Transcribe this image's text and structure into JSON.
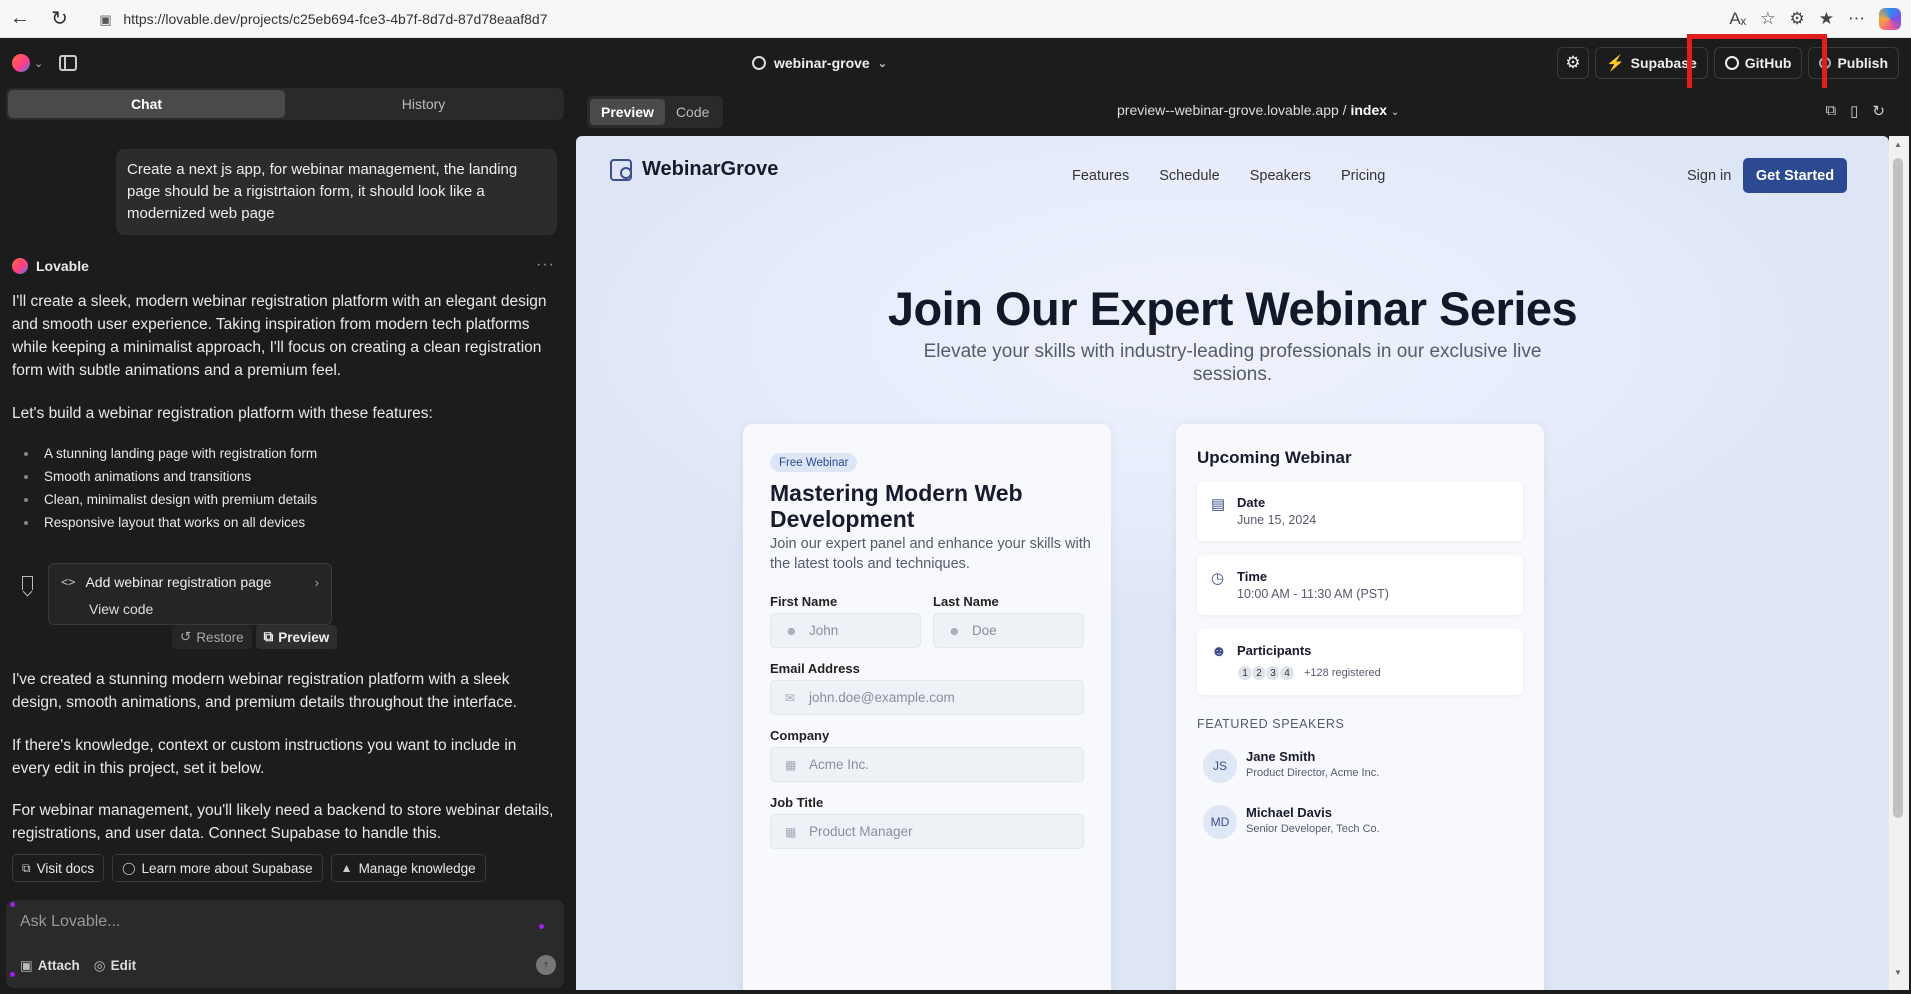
{
  "browser": {
    "url": "https://lovable.dev/projects/c25eb694-fce3-4b7f-8d7d-87d78eaaf8d7"
  },
  "header": {
    "project_name": "webinar-grove",
    "supabase_label": "Supabase",
    "github_label": "GitHub",
    "publish_label": "Publish"
  },
  "chat": {
    "tabs": [
      "Chat",
      "History"
    ],
    "user_message": "Create a next js app, for webinar management, the landing page should be a rigistrtaion form, it should look like a modernized web page",
    "bot_name": "Lovable",
    "intro": "I'll create a sleek, modern webinar registration platform with an elegant design and smooth user experience. Taking inspiration from modern tech platforms while keeping a minimalist approach, I'll focus on creating a clean registration form with subtle animations and a premium feel.",
    "features_intro": "Let's build a webinar registration platform with these features:",
    "features": [
      "A stunning landing page with registration form",
      "Smooth animations and transitions",
      "Clean, minimalist design with premium details",
      "Responsive layout that works on all devices"
    ],
    "version_title": "Add webinar registration page",
    "version_view_code": "View code",
    "restore_label": "Restore",
    "preview_label": "Preview",
    "done_msg": "I've created a stunning modern webinar registration platform with a sleek design, smooth animations, and premium details throughout the interface.",
    "knowledge_msg": "If there's knowledge, context or custom instructions you want to include in every edit in this project, set it below.",
    "supabase_msg": "For webinar management, you'll likely need a backend to store webinar details, registrations, and user data. Connect Supabase to handle this.",
    "buttons": [
      "Visit docs",
      "Learn more about Supabase",
      "Manage knowledge"
    ],
    "input_placeholder": "Ask Lovable...",
    "attach_label": "Attach",
    "edit_label": "Edit"
  },
  "preview": {
    "tabs": [
      "Preview",
      "Code"
    ],
    "url_host": "preview--webinar-grove.lovable.app",
    "url_sep": " / ",
    "url_page": "index"
  },
  "site": {
    "brand": "WebinarGrove",
    "nav": [
      "Features",
      "Schedule",
      "Speakers",
      "Pricing"
    ],
    "sign_in": "Sign in",
    "cta": "Get Started",
    "hero_title": "Join Our Expert Webinar Series",
    "hero_sub": "Elevate your skills with industry-leading professionals in our exclusive live sessions.",
    "form": {
      "badge": "Free Webinar",
      "title": "Mastering Modern Web Development",
      "desc": "Join our expert panel and enhance your skills with the latest tools and techniques.",
      "first_name_label": "First Name",
      "first_name_ph": "John",
      "last_name_label": "Last Name",
      "last_name_ph": "Doe",
      "email_label": "Email Address",
      "email_ph": "john.doe@example.com",
      "company_label": "Company",
      "company_ph": "Acme Inc.",
      "job_label": "Job Title",
      "job_ph": "Product Manager"
    },
    "upcoming": {
      "title": "Upcoming Webinar",
      "date_label": "Date",
      "date_value": "June 15, 2024",
      "time_label": "Time",
      "time_value": "10:00 AM - 11:30 AM (PST)",
      "participants_label": "Participants",
      "avatars": [
        "1",
        "2",
        "3",
        "4"
      ],
      "registered": "+128 registered",
      "speakers_heading": "FEATURED SPEAKERS",
      "speakers": [
        {
          "initials": "JS",
          "name": "Jane Smith",
          "role": "Product Director, Acme Inc."
        },
        {
          "initials": "MD",
          "name": "Michael Davis",
          "role": "Senior Developer, Tech Co."
        }
      ]
    }
  },
  "colors": {
    "highlight": "#e11d1d",
    "brand_button": "#2c4a91",
    "supabase_green": "#3ecf8e"
  }
}
